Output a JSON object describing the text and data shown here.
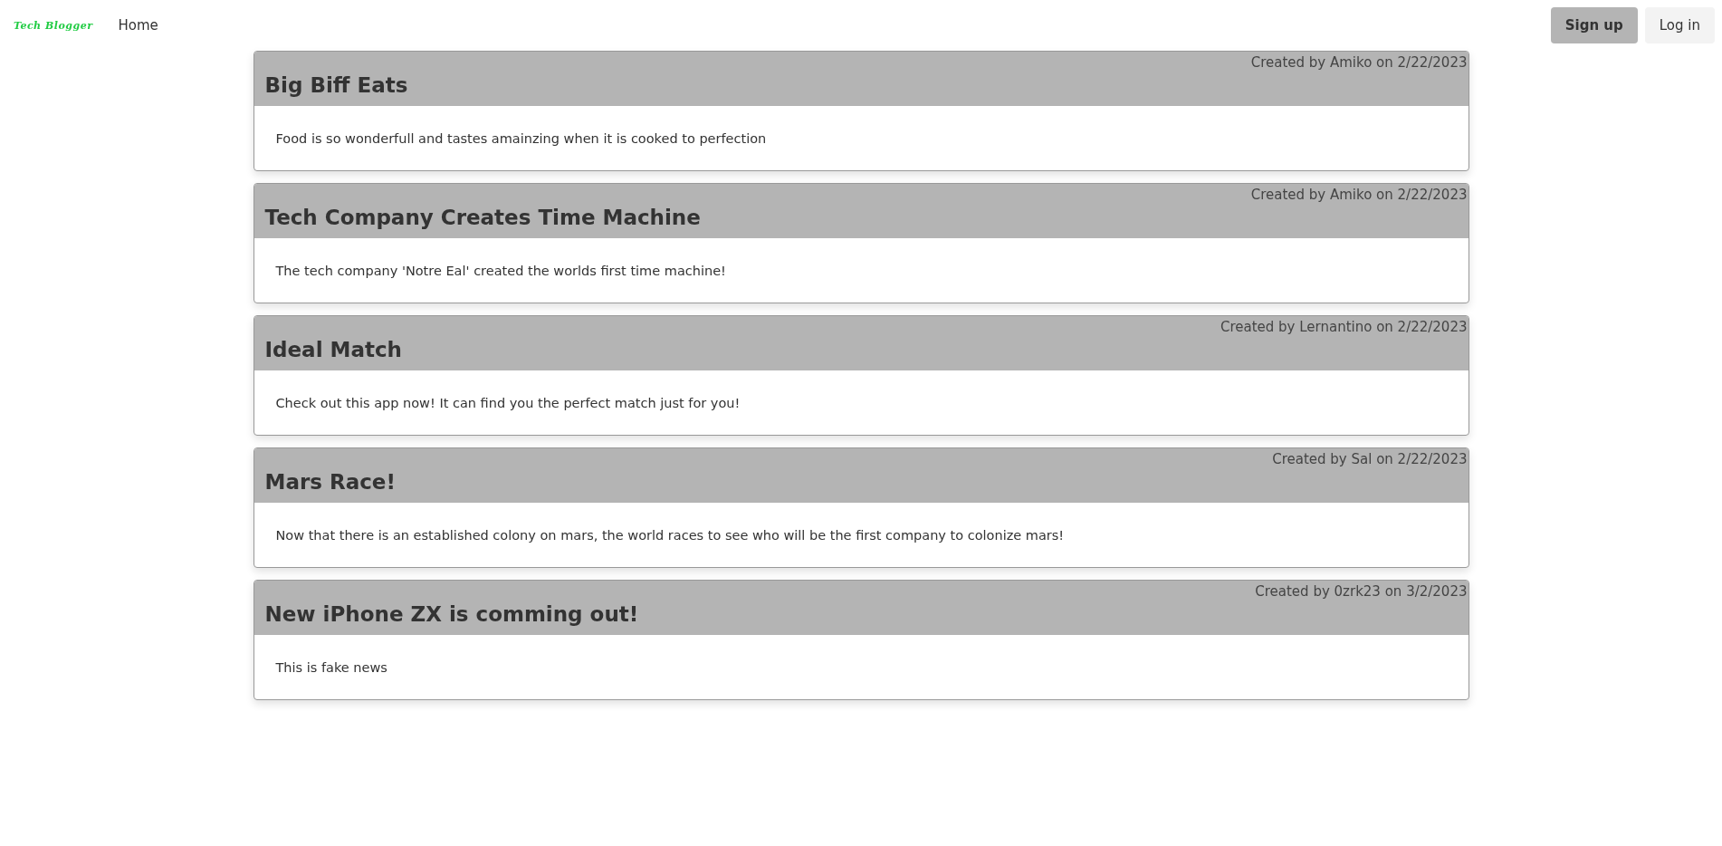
{
  "navbar": {
    "logo": "Tech Blogger",
    "links": [
      {
        "label": "Home"
      }
    ],
    "buttons": [
      {
        "label": "Sign up",
        "kind": "primary"
      },
      {
        "label": "Log in",
        "kind": "secondary"
      }
    ]
  },
  "posts": [
    {
      "title": "Big Biff Eats",
      "meta": "Created by Amiko on 2/22/2023",
      "body": "Food is so wonderfull and tastes amainzing when it is cooked to perfection"
    },
    {
      "title": "Tech Company Creates Time Machine",
      "meta": "Created by Amiko on 2/22/2023",
      "body": "The tech company 'Notre Eal' created the worlds first time machine!"
    },
    {
      "title": "Ideal Match",
      "meta": "Created by Lernantino on 2/22/2023",
      "body": "Check out this app now! It can find you the perfect match just for you!"
    },
    {
      "title": "Mars Race!",
      "meta": "Created by Sal on 2/22/2023",
      "body": "Now that there is an established colony on mars, the world races to see who will be the first company to colonize mars!"
    },
    {
      "title": "New iPhone ZX is comming out!",
      "meta": "Created by 0zrk23 on 3/2/2023",
      "body": "This is fake news"
    }
  ]
}
